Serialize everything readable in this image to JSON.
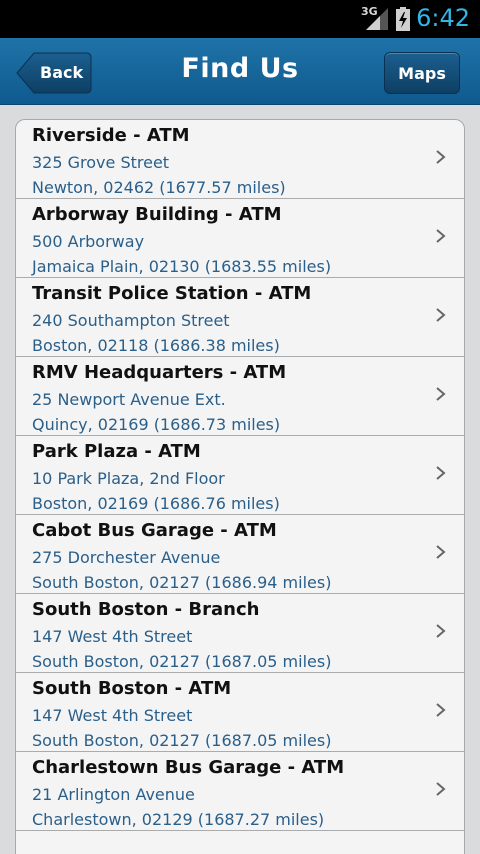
{
  "status_bar": {
    "network": "3G",
    "time": "6:42"
  },
  "header": {
    "title": "Find Us",
    "back_label": "Back",
    "maps_label": "Maps"
  },
  "locations": [
    {
      "name": "Riverside - ATM",
      "address": "325 Grove Street",
      "city_line": "Newton, 02462 (1677.57 miles)"
    },
    {
      "name": "Arborway Building - ATM",
      "address": "500 Arborway",
      "city_line": "Jamaica Plain, 02130 (1683.55 miles)"
    },
    {
      "name": "Transit Police Station - ATM",
      "address": "240 Southampton Street",
      "city_line": "Boston, 02118 (1686.38 miles)"
    },
    {
      "name": "RMV Headquarters - ATM",
      "address": "25 Newport Avenue Ext.",
      "city_line": "Quincy, 02169 (1686.73 miles)"
    },
    {
      "name": "Park Plaza - ATM",
      "address": "10 Park Plaza, 2nd Floor",
      "city_line": "Boston, 02169 (1686.76 miles)"
    },
    {
      "name": "Cabot Bus Garage - ATM",
      "address": "275 Dorchester Avenue",
      "city_line": "South Boston, 02127 (1686.94 miles)"
    },
    {
      "name": "South Boston - Branch",
      "address": "147 West 4th Street",
      "city_line": "South Boston, 02127 (1687.05 miles)"
    },
    {
      "name": "South Boston - ATM",
      "address": "147 West 4th Street",
      "city_line": "South Boston, 02127 (1687.05 miles)"
    },
    {
      "name": "Charlestown Bus Garage - ATM",
      "address": "21 Arlington Avenue",
      "city_line": "Charlestown, 02129 (1687.27 miles)"
    }
  ]
}
